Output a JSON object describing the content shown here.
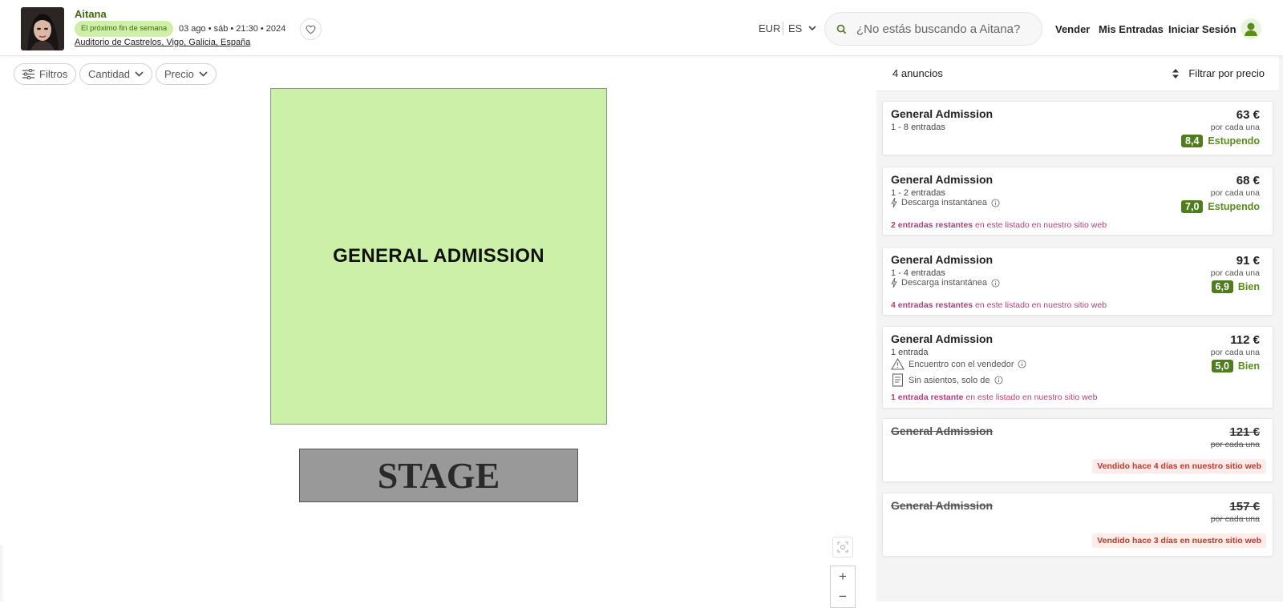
{
  "event": {
    "title": "Aitana",
    "badge": "El próximo fin de semana",
    "date": "03 ago • sáb • 21:30 • 2024",
    "venue": "Auditorio de Castrelos, Vigo, Galicia, España"
  },
  "header": {
    "currency": "EUR",
    "language": "ES",
    "search_placeholder": "¿No estás buscando a Aitana?",
    "nav": {
      "sell": "Vender",
      "my_tickets": "Mis Entradas",
      "login": "Iniciar Sesión"
    }
  },
  "filters": {
    "filters_label": "Filtros",
    "quantity_label": "Cantidad",
    "price_label": "Precio"
  },
  "map": {
    "general_admission": "GENERAL ADMISSION",
    "stage": "STAGE",
    "zoom_in": "+",
    "zoom_out": "−"
  },
  "listing_panel": {
    "count": "4 anuncios",
    "sort_label": "Filtrar por precio",
    "listings": [
      {
        "name": "General Admission",
        "qty": "1 - 8 entradas",
        "price": "63 €",
        "per": "por cada una",
        "score": "8,4",
        "rating_label": "Estupendo"
      },
      {
        "name": "General Admission",
        "qty": "1 - 2 entradas",
        "feature": "Descarga instantánea",
        "price": "68 €",
        "per": "por cada una",
        "score": "7,0",
        "rating_label": "Estupendo",
        "remaining_bold": "2 entradas restantes",
        "remaining_rest": " en este listado en nuestro sitio web"
      },
      {
        "name": "General Admission",
        "qty": "1 - 4 entradas",
        "feature": "Descarga instantánea",
        "price": "91 €",
        "per": "por cada una",
        "score": "6,9",
        "rating_label": "Bien",
        "remaining_bold": "4 entradas restantes",
        "remaining_rest": " en este listado en nuestro sitio web"
      },
      {
        "name": "General Admission",
        "qty": "1 entrada",
        "feature1": "Encuentro con el vendedor",
        "feature2": "Sin asientos, solo de",
        "price": "112 €",
        "per": "por cada una",
        "score": "5,0",
        "rating_label": "Bien",
        "remaining_bold": "1 entrada restante",
        "remaining_rest": " en este listado en nuestro sitio web"
      },
      {
        "name": "General Admission",
        "price": "121 €",
        "per": "por cada una",
        "sold_label": "Vendido hace 4 días en nuestro sitio web"
      },
      {
        "name": "General Admission",
        "price": "157 €",
        "per": "por cada una",
        "sold_label": "Vendido hace 3 días en nuestro sitio web"
      }
    ]
  },
  "colors": {
    "accent_green": "#4f7d1d",
    "ga_fill": "#cdf0a9",
    "stage_fill": "#999999",
    "remaining_pink": "#b5407a",
    "sold_red": "#c0392b"
  }
}
